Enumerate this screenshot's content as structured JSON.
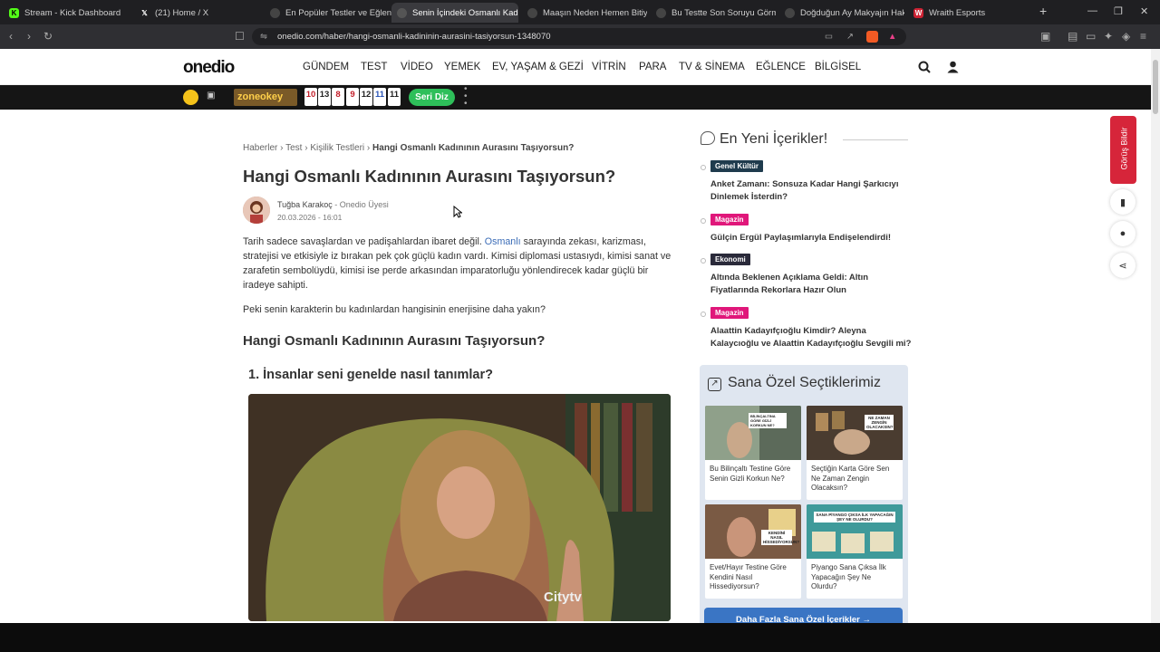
{
  "browser": {
    "tabs": [
      {
        "label": "Stream - Kick Dashboard"
      },
      {
        "label": "(21) Home / X"
      },
      {
        "label": "En Popüler Testler ve Eğlenceli"
      },
      {
        "label": "Senin İçindeki Osmanlı Kad"
      },
      {
        "label": "Maaşın Neden Hemen Bitiyor?"
      },
      {
        "label": "Bu Testte Son Soruyu Görmek"
      },
      {
        "label": "Doğduğun Ay Makyajın Hakkı"
      },
      {
        "label": "Wraith Esports"
      }
    ],
    "url": "onedio.com/haber/hangi-osmanli-kadininin-aurasini-tasiyorsun-1348070"
  },
  "header": {
    "logo": "onedio",
    "nav": [
      "GÜNDEM",
      "TEST",
      "VİDEO",
      "YEMEK",
      "EV, YAŞAM & GEZİ",
      "VİTRİN",
      "PARA",
      "TV & SİNEMA",
      "EĞLENCE",
      "BİLGİSEL"
    ]
  },
  "ad": {
    "brand": "zoneokey",
    "numbers": [
      "10",
      "13",
      "8",
      "9",
      "12",
      "11",
      "11"
    ],
    "button": "Seri Diz"
  },
  "article": {
    "breadcrumb": {
      "items": [
        "Haberler",
        "Test",
        "Kişilik Testleri"
      ],
      "current": "Hangi Osmanlı Kadınının Aurasını Taşıyorsun?"
    },
    "title": "Hangi Osmanlı Kadınının Aurasını Taşıyorsun?",
    "author": "Tuğba Karakoç",
    "author_role": "- Onedio Üyesi",
    "date": "20.03.2026 - 16:01",
    "intro_before": "Tarih sadece savaşlardan ve padişahlardan ibaret değil.",
    "intro_link": "Osmanlı",
    "intro_after": "sarayında zekası, karizması, stratejisi ve etkisiyle iz bırakan pek çok güçlü kadın vardı. Kimisi diplomasi ustasıydı, kimisi sanat ve zarafetin sembolüydü, kimisi ise perde arkasından imparatorluğu yönlendirecek kadar güçlü bir iradeye sahipti.",
    "para2": "Peki senin karakterin bu kadınlardan hangisinin enerjisine daha yakın?",
    "heading": "Hangi Osmanlı Kadınının Aurasını Taşıyorsun?",
    "question": "1. İnsanlar seni genelde nasıl tanımlar?",
    "media_watermark": "Citytv"
  },
  "sidebar": {
    "title": "En Yeni İçerikler!",
    "news": [
      {
        "category": "Genel Kültür",
        "color": "#1f3b4d",
        "title": "Anket Zamanı: Sonsuza Kadar Hangi Şarkıcıyı Dinlemek İsterdin?"
      },
      {
        "category": "Magazin",
        "color": "#e0177a",
        "title": "Gülçin Ergül Paylaşımlarıyla Endişelendirdi!"
      },
      {
        "category": "Ekonomi",
        "color": "#2a2a3a",
        "title": "Altında Beklenen Açıklama Geldi: Altın Fiyatlarında Rekorlara Hazır Olun"
      },
      {
        "category": "Magazin",
        "color": "#e0177a",
        "title": "Alaattin Kadayıfçıoğlu Kimdir? Aleyna Kalaycıoğlu ve Alaattin Kadayıfçıoğlu Sevgili mi?"
      }
    ],
    "picks_title": "Sana Özel Seçtiklerimiz",
    "picks": [
      {
        "caption": "Bu Bilinçaltı Testine Göre Senin Gizli Korkun Ne?",
        "badge": "BİLİNÇALTINA GÖRE GİZLİ KORKUN NE?"
      },
      {
        "caption": "Seçtiğin Karta Göre Sen Ne Zaman Zengin Olacaksın?",
        "badge": "NE ZAMAN ZENGİN OLACAKSIN?"
      },
      {
        "caption": "Evet/Hayır Testine Göre Kendini Nasıl Hissediyorsun?",
        "badge": "KENDİNİ NASIL HİSSEDİYORSUN?"
      },
      {
        "caption": "Piyango Sana Çıksa İlk Yapacağın Şey Ne Olurdu?",
        "badge": "SANA PİYANGO ÇIKSA İLK YAPACAĞIN ŞEY NE OLURDU?"
      }
    ],
    "more_button": "Daha Fazla Sana Özel İçerikler →"
  },
  "feedback": "Görüş Bildir"
}
